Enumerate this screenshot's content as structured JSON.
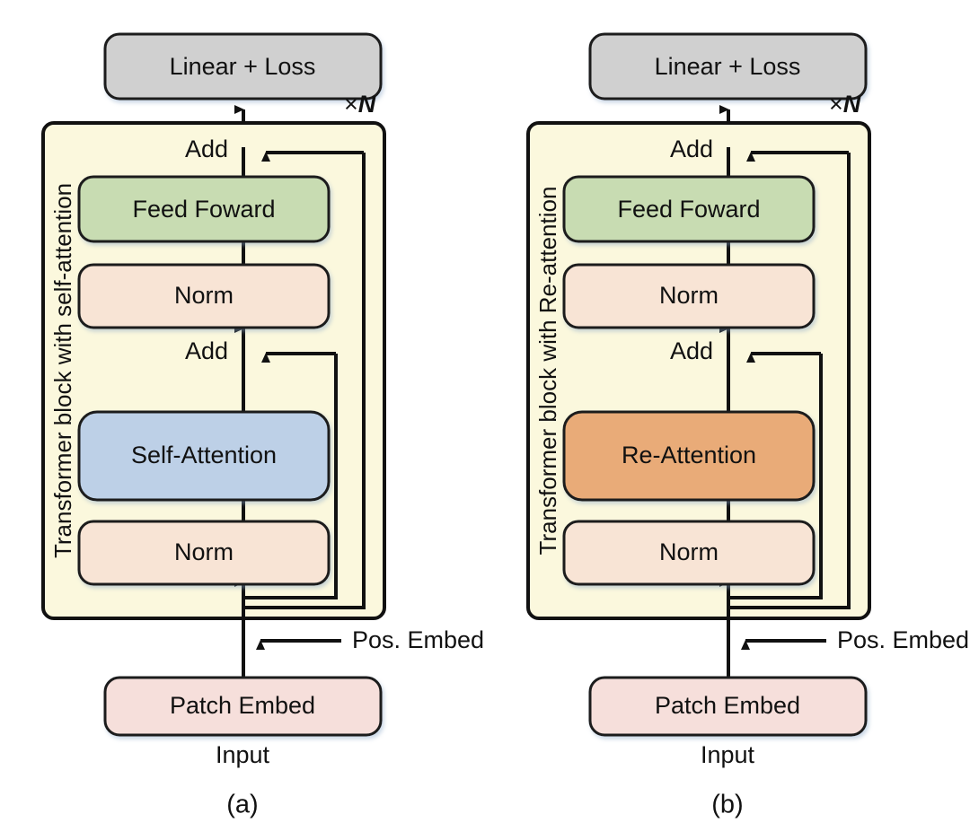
{
  "figure": {
    "title": "Transformer block architectures: self-attention vs Re-attention",
    "background_color": "#ffffff"
  },
  "palette": {
    "block_background": "#fbf8dd",
    "block_border": "#111111",
    "linear_loss_fill": "#d0d0d0",
    "feed_forward_fill": "#c8dcb2",
    "norm_fill": "#f8e4d5",
    "self_attention_fill": "#bdd0e7",
    "re_attention_fill": "#e9ab78",
    "patch_embed_fill": "#f6dfdb",
    "line_color": "#111111",
    "text_color": "#111111"
  },
  "panels": [
    {
      "id": "panel-a",
      "caption": "(a)",
      "block_label": "Transformer block with self-attention",
      "repeat_label_prefix": "×",
      "repeat_label_symbol": "N",
      "head_box": {
        "label": "Linear + Loss",
        "fill": "#d0d0d0"
      },
      "stages": [
        {
          "name": "add-top",
          "label": "Add",
          "kind": "text"
        },
        {
          "name": "feed-forward",
          "label": "Feed Foward",
          "fill": "#c8dcb2",
          "kind": "box"
        },
        {
          "name": "norm-upper",
          "label": "Norm",
          "fill": "#f8e4d5",
          "kind": "box"
        },
        {
          "name": "add-bottom",
          "label": "Add",
          "kind": "text"
        },
        {
          "name": "attention",
          "label": "Self-Attention",
          "fill": "#bdd0e7",
          "kind": "box"
        },
        {
          "name": "norm-lower",
          "label": "Norm",
          "fill": "#f8e4d5",
          "kind": "box"
        }
      ],
      "pos_embed_label": "Pos. Embed",
      "patch_embed": {
        "label": "Patch Embed",
        "fill": "#f6dfdb"
      },
      "input_label": "Input"
    },
    {
      "id": "panel-b",
      "caption": "(b)",
      "block_label": "Transformer block with Re-attention",
      "repeat_label_prefix": "×",
      "repeat_label_symbol": "N",
      "head_box": {
        "label": "Linear + Loss",
        "fill": "#d0d0d0"
      },
      "stages": [
        {
          "name": "add-top",
          "label": "Add",
          "kind": "text"
        },
        {
          "name": "feed-forward",
          "label": "Feed Foward",
          "fill": "#c8dcb2",
          "kind": "box"
        },
        {
          "name": "norm-upper",
          "label": "Norm",
          "fill": "#f8e4d5",
          "kind": "box"
        },
        {
          "name": "add-bottom",
          "label": "Add",
          "kind": "text"
        },
        {
          "name": "attention",
          "label": "Re-Attention",
          "fill": "#e9ab78",
          "kind": "box"
        },
        {
          "name": "norm-lower",
          "label": "Norm",
          "fill": "#f8e4d5",
          "kind": "box"
        }
      ],
      "pos_embed_label": "Pos. Embed",
      "patch_embed": {
        "label": "Patch Embed",
        "fill": "#f6dfdb"
      },
      "input_label": "Input"
    }
  ]
}
